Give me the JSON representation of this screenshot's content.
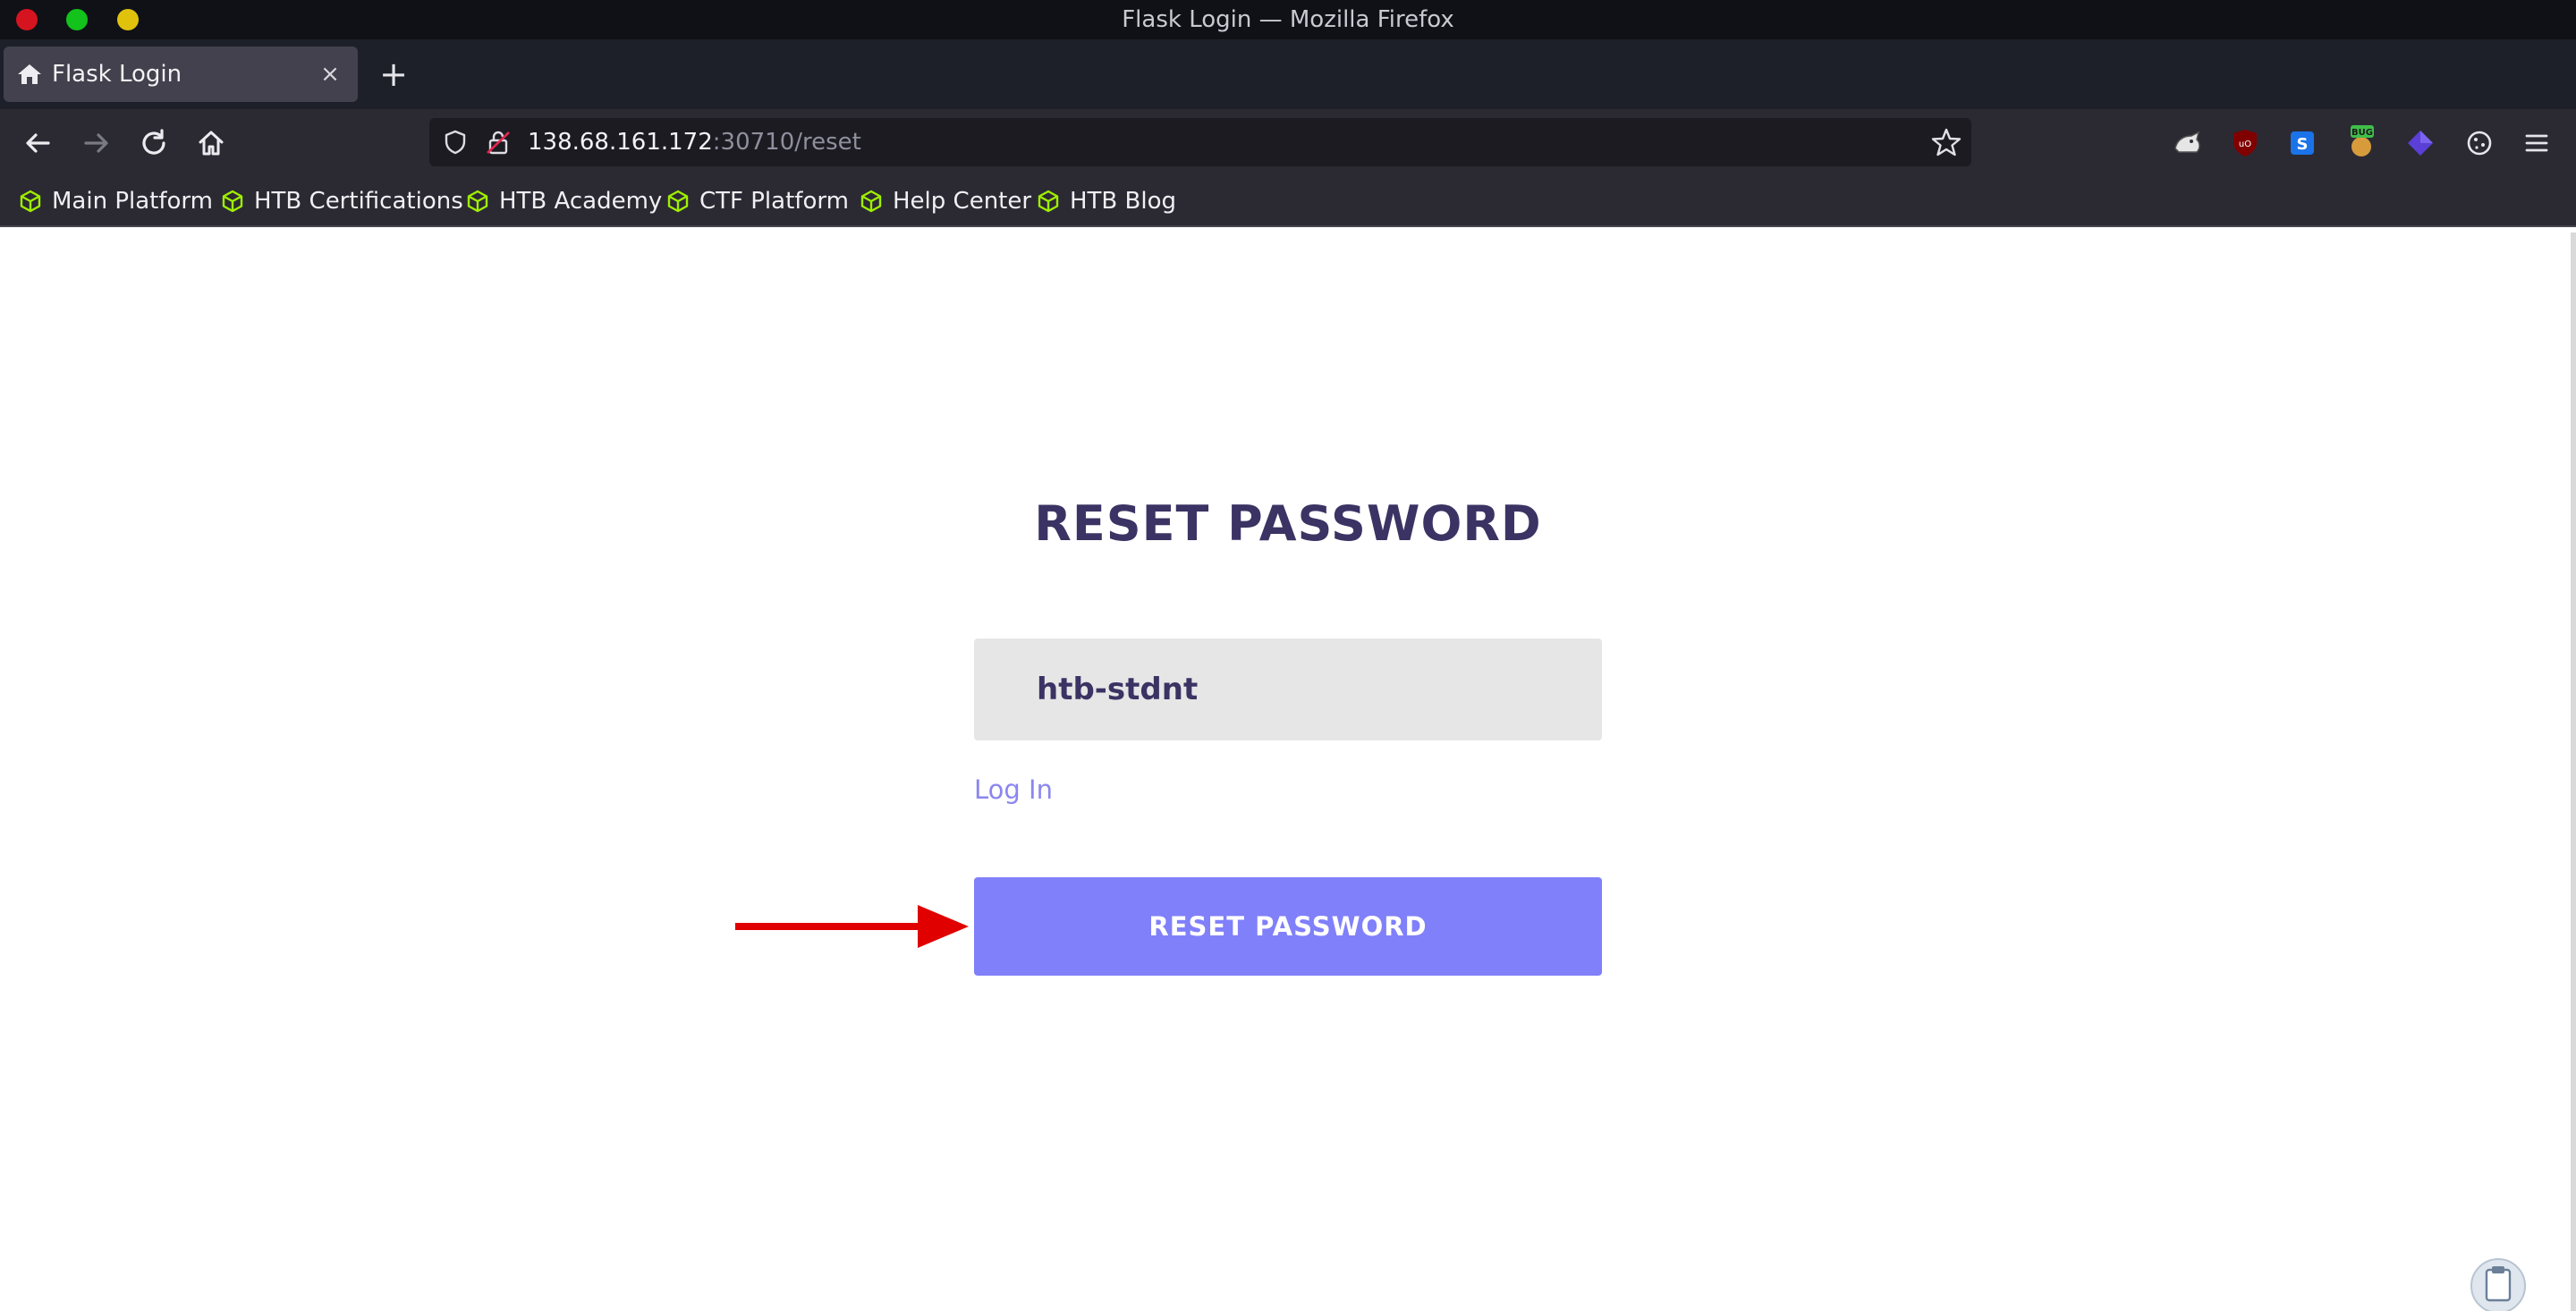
{
  "window": {
    "title": "Flask Login — Mozilla Firefox"
  },
  "tab": {
    "title": "Flask Login",
    "close_glyph": "×",
    "new_tab_glyph": "+"
  },
  "urlbar": {
    "host": "138.68.161.172",
    "rest": ":30710/reset"
  },
  "bookmarks": [
    {
      "label": "Main Platform",
      "icon": "htb-cube-icon"
    },
    {
      "label": "HTB Certifications",
      "icon": "htb-cube-icon"
    },
    {
      "label": "HTB Academy",
      "icon": "htb-cube-icon"
    },
    {
      "label": "CTF Platform",
      "icon": "htb-cube-icon"
    },
    {
      "label": "Help Center",
      "icon": "htb-cube-icon"
    },
    {
      "label": "HTB Blog",
      "icon": "htb-cube-icon"
    }
  ],
  "extensions": [
    "foxyproxy-icon",
    "ublock-icon",
    "s-extension-icon",
    "bug-extension-icon",
    "purple-extension-icon",
    "cookie-icon",
    "menu-icon"
  ],
  "page": {
    "heading": "RESET PASSWORD",
    "username_value": "htb-stdnt",
    "login_link": "Log In",
    "reset_button": "RESET PASSWORD"
  },
  "colors": {
    "heading": "#3b3363",
    "button": "#8080fa",
    "link": "#8b86f0",
    "input_bg": "#e6e6e6",
    "annotation_arrow": "#e00000"
  }
}
